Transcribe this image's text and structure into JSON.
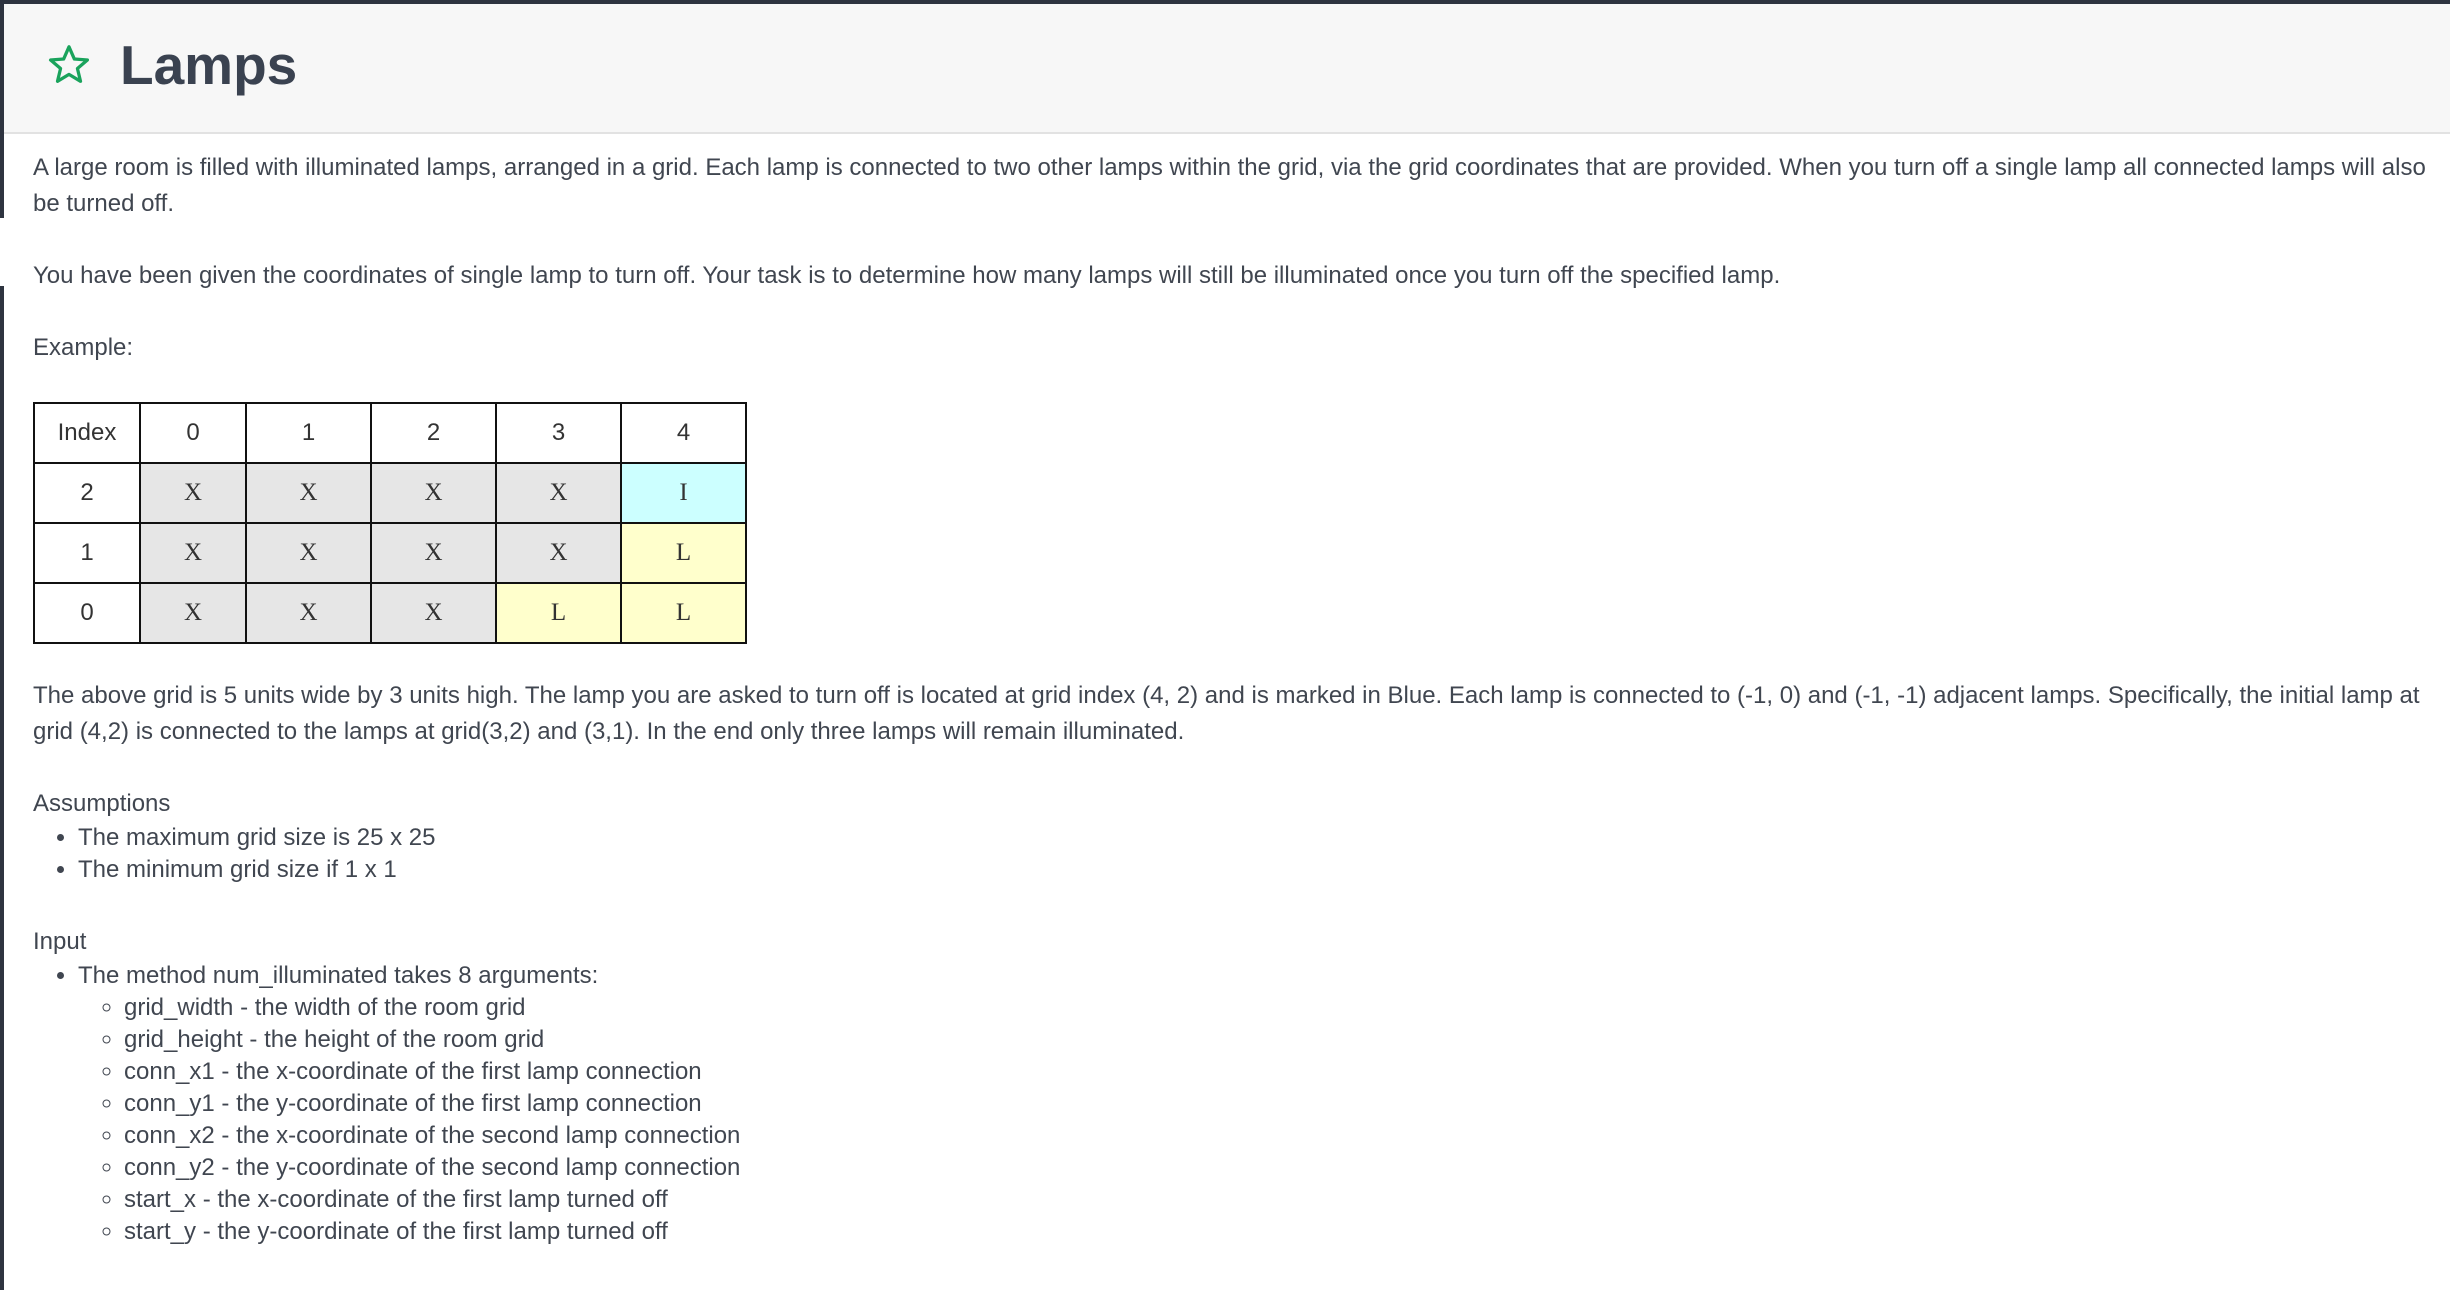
{
  "header": {
    "title": "Lamps",
    "star_color": "#1aa35c"
  },
  "intro": {
    "paragraph1": "A large room is filled with illuminated lamps, arranged in a grid. Each lamp is connected to two other lamps within the grid, via the grid coordinates that are provided. When you turn off a single lamp all connected lamps will also be turned off.",
    "paragraph2": "You have been given the coordinates of single lamp to turn off. Your task is to determine how many lamps will still be illuminated once you turn off the specified lamp.",
    "example_label": "Example:"
  },
  "table": {
    "header": [
      "Index",
      "0",
      "1",
      "2",
      "3",
      "4"
    ],
    "rows": [
      {
        "index": "2",
        "cells": [
          "X",
          "X",
          "X",
          "X",
          "I"
        ],
        "states": [
          "off",
          "off",
          "off",
          "off",
          "start"
        ]
      },
      {
        "index": "1",
        "cells": [
          "X",
          "X",
          "X",
          "X",
          "L"
        ],
        "states": [
          "off",
          "off",
          "off",
          "off",
          "lit"
        ]
      },
      {
        "index": "0",
        "cells": [
          "X",
          "X",
          "X",
          "L",
          "L"
        ],
        "states": [
          "off",
          "off",
          "off",
          "lit",
          "lit"
        ]
      }
    ],
    "colors": {
      "off": "#e6e6e6",
      "lit": "#ffffcc",
      "start": "#ccffff"
    }
  },
  "explanation": "The above grid is 5 units wide by 3 units high. The lamp you are asked to turn off is located at grid index (4, 2) and is marked in Blue. Each lamp is connected to (-1, 0) and (-1, -1) adjacent lamps. Specifically, the initial lamp at grid (4,2) is connected to the lamps at grid(3,2) and (3,1). In the end only three lamps will remain illuminated.",
  "assumptions": {
    "heading": "Assumptions",
    "items": [
      "The maximum grid size is 25 x 25",
      "The minimum grid size if 1 x 1"
    ]
  },
  "input": {
    "heading": "Input",
    "method_text": "The method num_illuminated takes 8 arguments:",
    "args": [
      "grid_width - the width of the room grid",
      "grid_height - the height of the room grid",
      "conn_x1 - the x-coordinate of the first lamp connection",
      "conn_y1 - the y-coordinate of the first lamp connection",
      "conn_x2 - the x-coordinate of the second lamp connection",
      "conn_y2 - the y-coordinate of the second lamp connection",
      "start_x - the x-coordinate of the first lamp turned off",
      "start_y - the y-coordinate of the first lamp turned off"
    ]
  }
}
